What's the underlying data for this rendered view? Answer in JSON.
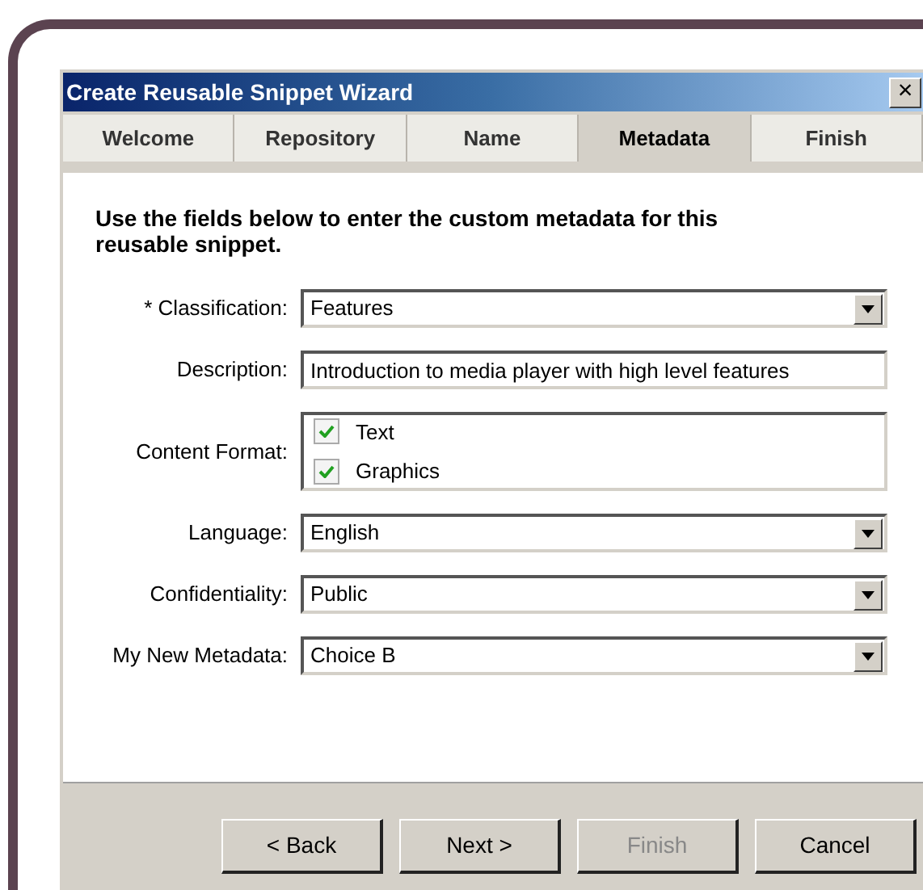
{
  "window": {
    "title": "Create Reusable Snippet Wizard",
    "close": "×"
  },
  "tabs": [
    {
      "label": "Welcome",
      "selected": false
    },
    {
      "label": "Repository",
      "selected": false
    },
    {
      "label": "Name",
      "selected": false
    },
    {
      "label": "Metadata",
      "selected": true
    },
    {
      "label": "Finish",
      "selected": false
    }
  ],
  "instructions": "Use the fields below to enter the custom metadata for this reusable snippet.",
  "fields": [
    {
      "kind": "select",
      "label": "* Classification:",
      "value": "Features"
    },
    {
      "kind": "text",
      "label": "Description:",
      "value": "Introduction to media player with high level features"
    },
    {
      "kind": "checklist",
      "label": "Content Format:",
      "options": [
        {
          "label": "Text",
          "checked": true
        },
        {
          "label": "Graphics",
          "checked": true
        }
      ]
    },
    {
      "kind": "select",
      "label": "Language:",
      "value": "English"
    },
    {
      "kind": "select",
      "label": "Confidentiality:",
      "value": "Public"
    },
    {
      "kind": "select",
      "label": "My New Metadata:",
      "value": "Choice B"
    }
  ],
  "buttons": [
    {
      "label": "< Back",
      "disabled": false
    },
    {
      "label": "Next >",
      "disabled": false
    },
    {
      "label": "Finish",
      "disabled": true
    },
    {
      "label": "Cancel",
      "disabled": false
    }
  ]
}
